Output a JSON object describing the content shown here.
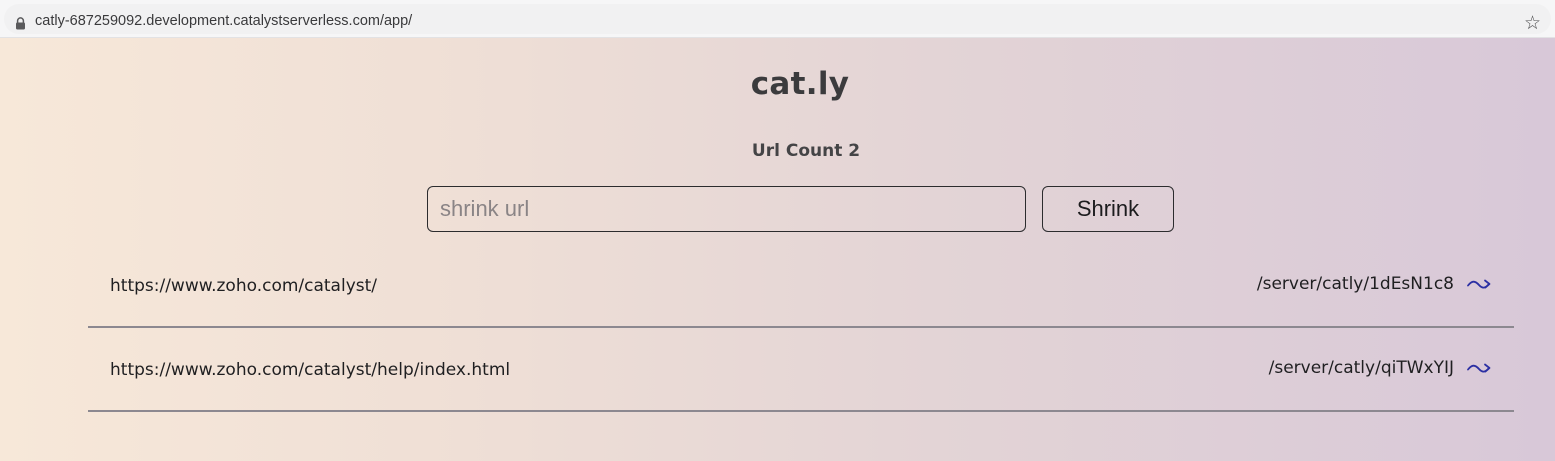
{
  "browser": {
    "url": "catly-687259092.development.catalystserverless.com/app/"
  },
  "app": {
    "title": "cat.ly",
    "url_count_label": "Url Count 2",
    "input_placeholder": "shrink url",
    "input_value": "",
    "button_label": "Shrink"
  },
  "urls": [
    {
      "long_url": "https://www.zoho.com/catalyst/",
      "short_url": "/server/catly/1dEsN1c8"
    },
    {
      "long_url": "https://www.zoho.com/catalyst/help/index.html",
      "short_url": "/server/catly/qiTWxYIJ"
    }
  ],
  "icons": {
    "lock": "lock-icon",
    "bookmark": "star-icon",
    "open_link": "arrow-icon"
  },
  "colors": {
    "arrow": "#2b2fa3",
    "gradient_start": "#f7e8d9",
    "gradient_end": "#d8c8d8"
  }
}
